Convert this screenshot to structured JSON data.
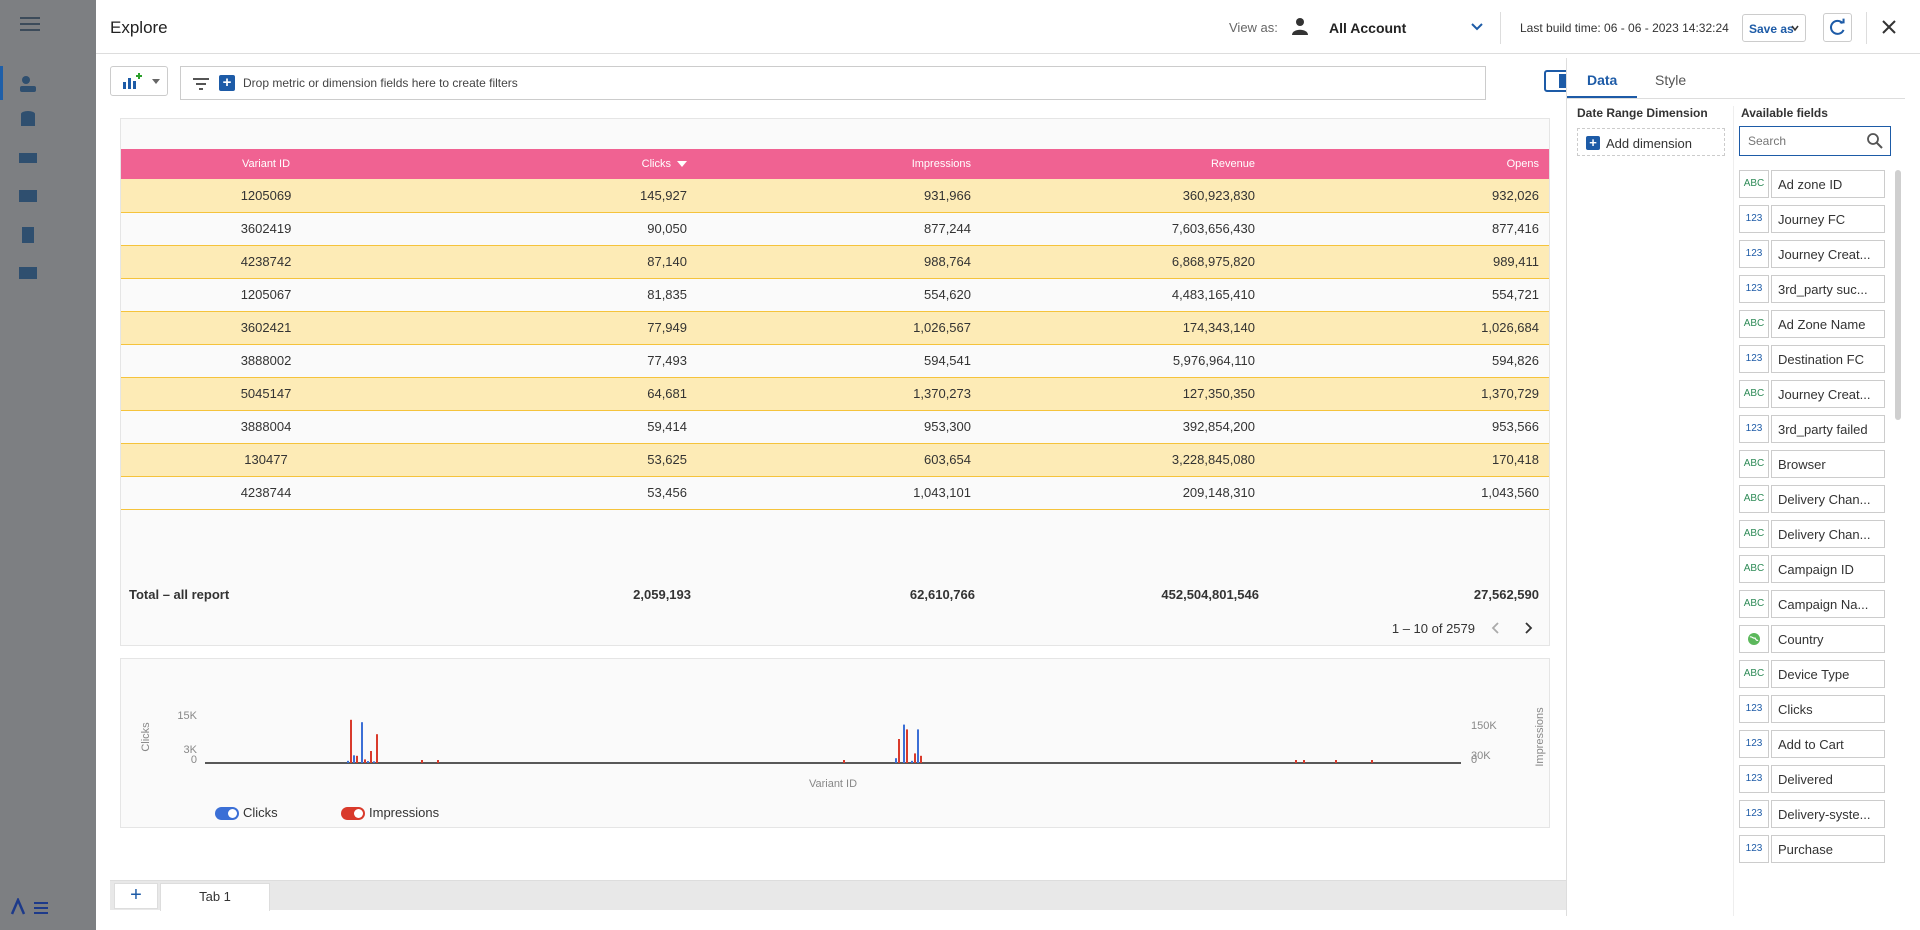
{
  "window": {
    "title": "Explore"
  },
  "header": {
    "view_as_label": "View as:",
    "account": "All Account",
    "last_build": "Last build time: 06 - 06 - 2023 14:32:24",
    "save_as": "Save as"
  },
  "filters": {
    "hint": "Drop metric or dimension fields here to create filters"
  },
  "table": {
    "columns": [
      "Variant ID",
      "Clicks",
      "Impressions",
      "Revenue",
      "Opens"
    ],
    "sorted_column": "Clicks",
    "rows": [
      [
        "1205069",
        "145,927",
        "931,966",
        "360,923,830",
        "932,026"
      ],
      [
        "3602419",
        "90,050",
        "877,244",
        "7,603,656,430",
        "877,416"
      ],
      [
        "4238742",
        "87,140",
        "988,764",
        "6,868,975,820",
        "989,411"
      ],
      [
        "1205067",
        "81,835",
        "554,620",
        "4,483,165,410",
        "554,721"
      ],
      [
        "3602421",
        "77,949",
        "1,026,567",
        "174,343,140",
        "1,026,684"
      ],
      [
        "3888002",
        "77,493",
        "594,541",
        "5,976,964,110",
        "594,826"
      ],
      [
        "5045147",
        "64,681",
        "1,370,273",
        "127,350,350",
        "1,370,729"
      ],
      [
        "3888004",
        "59,414",
        "953,300",
        "392,854,200",
        "953,566"
      ],
      [
        "130477",
        "53,625",
        "603,654",
        "3,228,845,080",
        "170,418"
      ],
      [
        "4238744",
        "53,456",
        "1,043,101",
        "209,148,310",
        "1,043,560"
      ]
    ],
    "total": {
      "label": "Total – all report",
      "clicks": "2,059,193",
      "impressions": "62,610,766",
      "revenue": "452,504,801,546",
      "opens": "27,562,590"
    },
    "pagination": "1 – 10 of 2579"
  },
  "chart_data": {
    "type": "bar",
    "xlabel": "Variant ID",
    "ylabel": "Clicks",
    "y2label": "Impressions",
    "y_ticks": [
      "15K",
      "3K",
      "0"
    ],
    "y2_ticks": [
      "150K",
      "30K",
      "0"
    ],
    "ylim": [
      0,
      20000
    ],
    "y2lim": [
      0,
      200000
    ],
    "series": [
      {
        "name": "Clicks",
        "color": "#3b6fd6",
        "values": [
          900,
          3200,
          17000,
          800,
          700,
          2000,
          16000,
          900,
          14000
        ]
      },
      {
        "name": "Impressions",
        "color": "#d93a2b",
        "values": [
          180000,
          30000,
          15000,
          50000,
          120000,
          100000,
          140000,
          40000,
          30000
        ]
      }
    ]
  },
  "legend": {
    "clicks": "Clicks",
    "impressions": "Impressions"
  },
  "tabs": {
    "add": "+",
    "tab1": "Tab 1"
  },
  "right_panel": {
    "tabs": [
      "Data",
      "Style"
    ],
    "date_range_label": "Date Range Dimension",
    "add_dimension": "Add dimension",
    "available_label": "Available fields",
    "search_placeholder": "Search",
    "fields": [
      {
        "type": "ABC",
        "name": "Ad zone ID"
      },
      {
        "type": "123",
        "name": "Journey FC"
      },
      {
        "type": "123",
        "name": "Journey Creat..."
      },
      {
        "type": "123",
        "name": "3rd_party suc..."
      },
      {
        "type": "ABC",
        "name": "Ad Zone Name"
      },
      {
        "type": "123",
        "name": "Destination FC"
      },
      {
        "type": "ABC",
        "name": "Journey Creat..."
      },
      {
        "type": "123",
        "name": "3rd_party failed"
      },
      {
        "type": "ABC",
        "name": "Browser"
      },
      {
        "type": "ABC",
        "name": "Delivery Chan..."
      },
      {
        "type": "ABC",
        "name": "Delivery Chan..."
      },
      {
        "type": "ABC",
        "name": "Campaign ID"
      },
      {
        "type": "ABC",
        "name": "Campaign Na..."
      },
      {
        "type": "GEO",
        "name": "Country"
      },
      {
        "type": "ABC",
        "name": "Device Type"
      },
      {
        "type": "123",
        "name": "Clicks"
      },
      {
        "type": "123",
        "name": "Add to Cart"
      },
      {
        "type": "123",
        "name": "Delivered"
      },
      {
        "type": "123",
        "name": "Delivery-syste..."
      },
      {
        "type": "123",
        "name": "Purchase"
      }
    ]
  },
  "colors": {
    "accent": "#1d5ba7",
    "header_row": "#f06292",
    "row_highlight": "#fdebb6"
  }
}
